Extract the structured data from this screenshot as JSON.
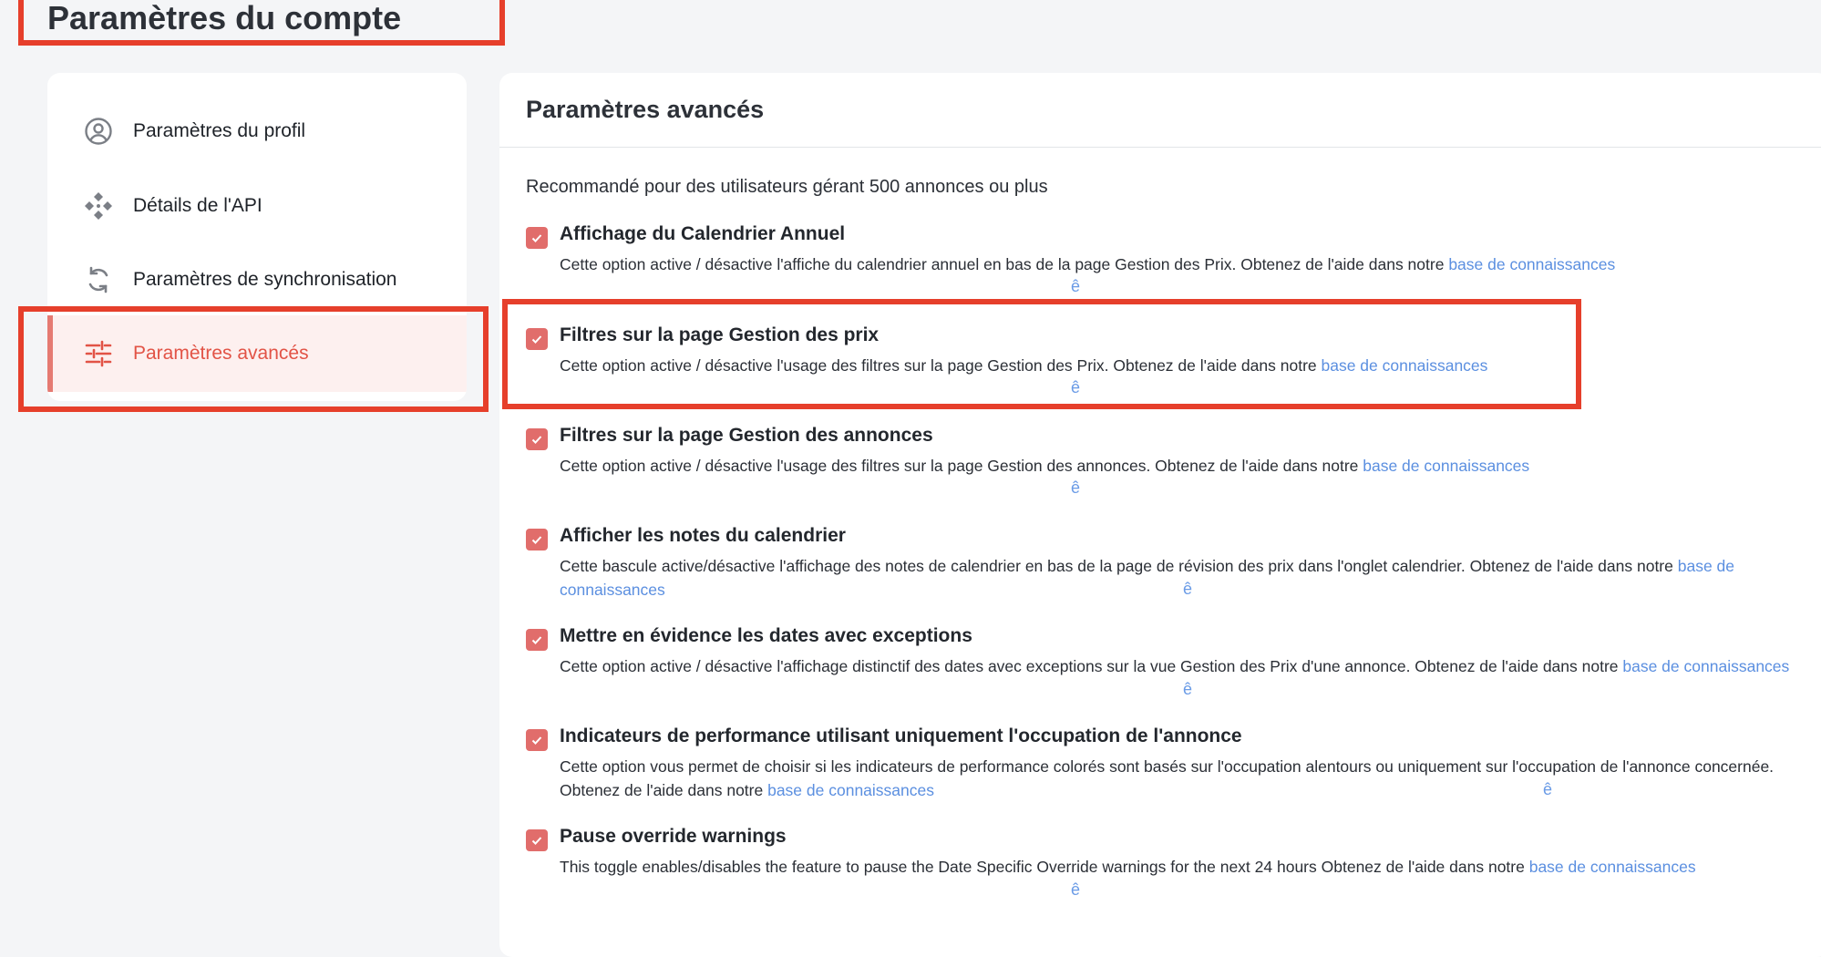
{
  "page": {
    "title": "Paramètres du compte"
  },
  "sidebar": {
    "items": [
      {
        "label": "Paramètres du profil",
        "icon": "user-circle-icon"
      },
      {
        "label": "Détails de l'API",
        "icon": "api-diamond-icon"
      },
      {
        "label": "Paramètres de synchronisation",
        "icon": "sync-icon"
      },
      {
        "label": "Paramètres avancés",
        "icon": "sliders-icon",
        "active": true
      }
    ]
  },
  "main": {
    "title": "Paramètres avancés",
    "intro": "Recommandé pour des utilisateurs gérant 500 annonces ou plus",
    "link_label": "base de connaissances",
    "glyph": "ê",
    "options": [
      {
        "title": "Affichage du Calendrier Annuel",
        "desc": "Cette option active / désactive l'affiche du calendrier annuel en bas de la page Gestion des Prix. Obtenez de l'aide dans notre ",
        "link": "base de connaissances",
        "checked": true
      },
      {
        "title": "Filtres sur la page Gestion des prix",
        "desc": "Cette option active / désactive l'usage des filtres sur la page Gestion des Prix. Obtenez de l'aide dans notre ",
        "link": "base de connaissances",
        "checked": true
      },
      {
        "title": "Filtres sur la page Gestion des annonces",
        "desc": "Cette option active / désactive l'usage des filtres sur la page Gestion des annonces. Obtenez de l'aide dans notre ",
        "link": "base de connaissances",
        "checked": true
      },
      {
        "title": "Afficher les notes du calendrier",
        "desc": "Cette bascule active/désactive l'affichage des notes de calendrier en bas de la page de révision des prix dans l'onglet calendrier. Obtenez de l'aide dans notre ",
        "link": "base de connaissances",
        "checked": true
      },
      {
        "title": "Mettre en évidence les dates avec exceptions",
        "desc": "Cette option active / désactive l'affichage distinctif des dates avec exceptions sur la vue Gestion des Prix d'une annonce. Obtenez de l'aide dans notre ",
        "link": "base de connaissances",
        "checked": true
      },
      {
        "title": "Indicateurs de performance utilisant uniquement l'occupation de l'annonce",
        "desc": "Cette option vous permet de choisir si les indicateurs de performance colorés sont basés sur l'occupation alentours ou uniquement sur l'occupation de l'annonce concernée. Obtenez de l'aide dans notre ",
        "link": "base de connaissances",
        "checked": true
      },
      {
        "title": "Pause override warnings",
        "desc": "This toggle enables/disables the feature to pause the Date Specific Override warnings for the next 24 hours Obtenez de l'aide dans notre ",
        "link": "base de connaissances",
        "checked": true
      }
    ]
  },
  "colors": {
    "accent": "#e25346",
    "checkbox": "#e16d6b",
    "link": "#5b8fe0",
    "highlight": "#e63f2b"
  }
}
